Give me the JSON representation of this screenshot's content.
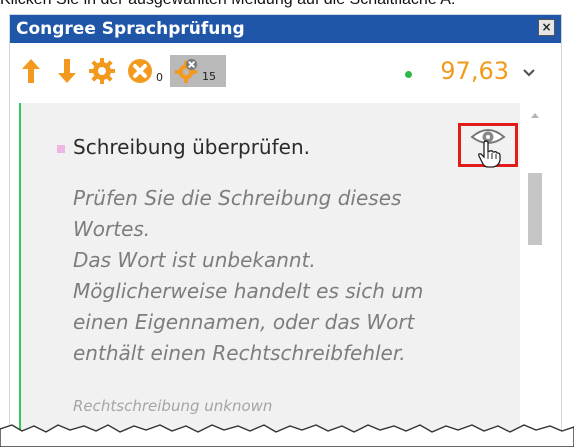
{
  "caption": {
    "text": "Klicken Sie in der ausgewählten Meldung auf die Schaltfläche A."
  },
  "window": {
    "title": "Congree Sprachprüfung",
    "close_label": "×"
  },
  "toolbar": {
    "error_count": "0",
    "suppressed_count": "15",
    "score": "97,63",
    "colors": {
      "icon_orange": "#f39a1e",
      "score_dot": "#2fb84a"
    },
    "icons": [
      "arrow-up-icon",
      "arrow-down-icon",
      "gear-icon",
      "error-circle-icon",
      "gear-suppressed-icon",
      "chevron-down-icon"
    ]
  },
  "message": {
    "title": "Schreibung überprüfen.",
    "description_lines": [
      "Prüfen Sie die Schreibung dieses",
      "Wortes.",
      "Das Wort ist unbekannt.",
      "Möglicherweise handelt es sich um",
      "einen Eigennamen, oder das Wort",
      "enthält einen Rechtschreibfehler."
    ],
    "rule": "Rechtschreibung unknown",
    "colors": {
      "status_bar": "#34c759",
      "highlight_box": "#e21b1b",
      "bullet": "#f0b6e3"
    }
  }
}
